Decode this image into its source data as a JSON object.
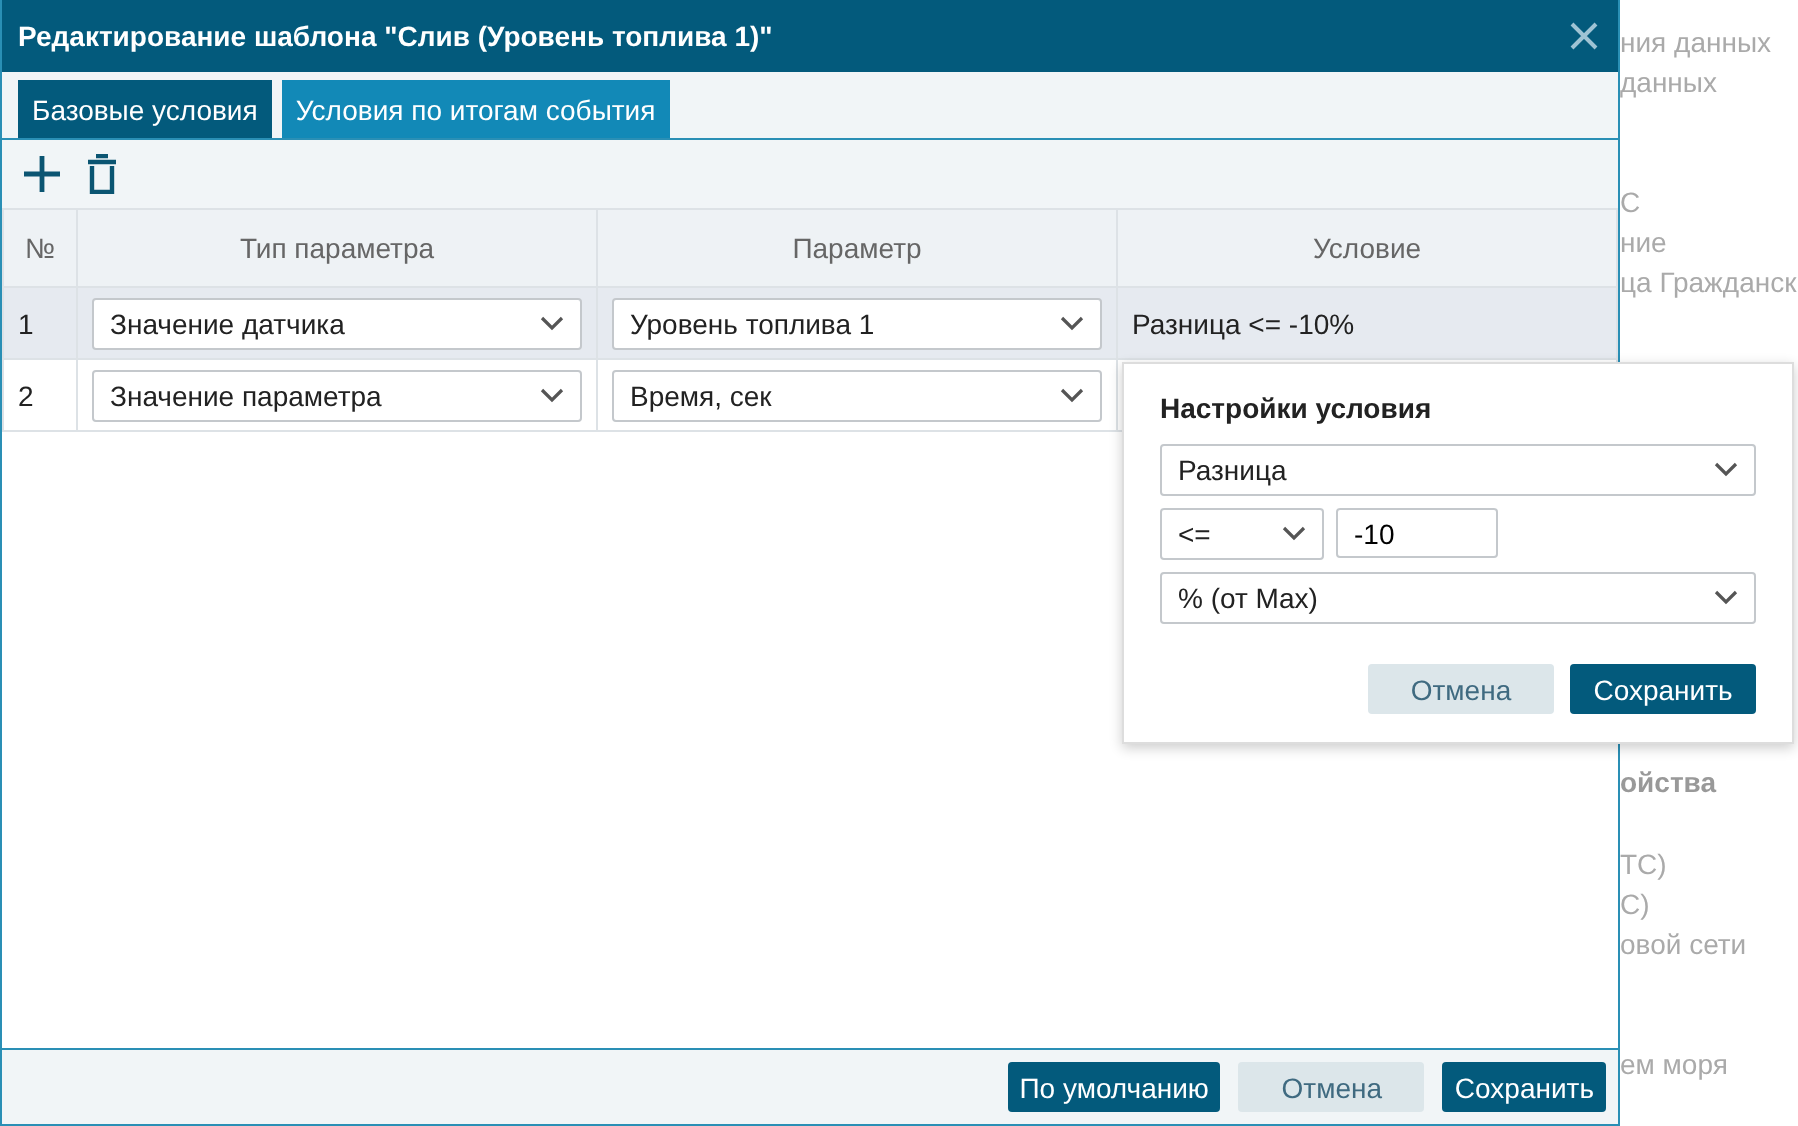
{
  "background_page": {
    "lines": [
      {
        "text": "ния данных",
        "bold": false
      },
      {
        "text": "данных",
        "bold": false
      },
      {
        "text": "С",
        "bold": false
      },
      {
        "text": "ние",
        "bold": false
      },
      {
        "text": "ца Гражданск",
        "bold": false
      },
      {
        "text": "ойства",
        "bold": true
      },
      {
        "text": "ТС)",
        "bold": false
      },
      {
        "text": "С)",
        "bold": false
      },
      {
        "text": "овой сети",
        "bold": false
      },
      {
        "text": "ем моря",
        "bold": false
      }
    ]
  },
  "window": {
    "title": "Редактирование шаблона \"Слив (Уровень топлива 1)\""
  },
  "tabs": [
    {
      "label": "Базовые условия",
      "selected": true
    },
    {
      "label": "Условия по итогам события",
      "selected": false
    }
  ],
  "table": {
    "columns": [
      "№",
      "Тип параметра",
      "Параметр",
      "Условие"
    ],
    "rows": [
      {
        "number": "1",
        "type": "Значение датчика",
        "parameter": "Уровень топлива 1",
        "condition": "Разница <= -10%",
        "selected": true
      },
      {
        "number": "2",
        "type": "Значение параметра",
        "parameter": "Время, сек",
        "condition": "",
        "selected": false
      }
    ]
  },
  "popover": {
    "title": "Настройки условия",
    "mode": "Разница",
    "operator": "<=",
    "value": "-10",
    "unit": "% (от Max)",
    "buttons": [
      {
        "label": "Отмена",
        "kind": "secondary"
      },
      {
        "label": "Сохранить",
        "kind": "primary"
      }
    ]
  },
  "footer_buttons": [
    {
      "label": "По умолчанию",
      "kind": "primary"
    },
    {
      "label": "Отмена",
      "kind": "secondary"
    },
    {
      "label": "Сохранить",
      "kind": "primary"
    }
  ]
}
